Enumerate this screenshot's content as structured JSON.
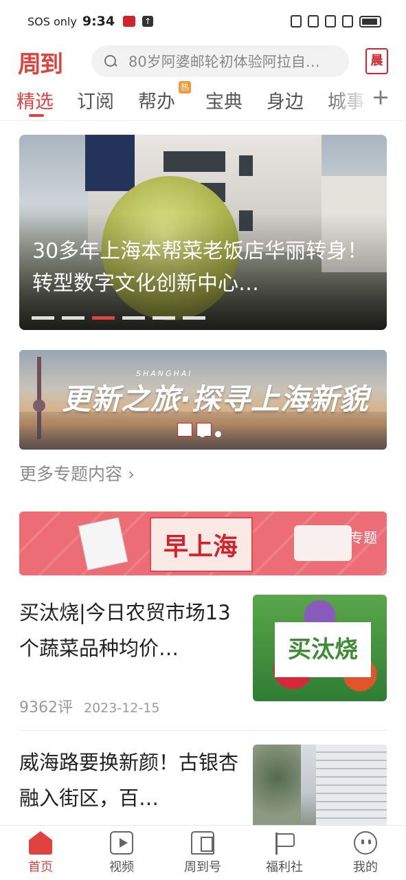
{
  "status_bar": {
    "carrier": "SOS only",
    "time": "9:34"
  },
  "header": {
    "logo": "周到",
    "search_placeholder": "80岁阿婆邮轮初体验阿拉自…",
    "badge_label": "晨"
  },
  "tabs": [
    {
      "label": "精选",
      "active": true
    },
    {
      "label": "订阅"
    },
    {
      "label": "帮办",
      "badge": "热"
    },
    {
      "label": "宝典"
    },
    {
      "label": "身边"
    },
    {
      "label": "城事"
    }
  ],
  "tabs_add_label": "+",
  "hero": {
    "title": "30多年上海本帮菜老饭店华丽转身！转型数字文化创新中心…",
    "dot_count": 6,
    "active_dot": 2
  },
  "topic_banner": {
    "title": "更新之旅·探寻上海新貌",
    "subtitle": "SHANGHAI"
  },
  "more_topics": "更多专题内容 ›",
  "morning_banner": {
    "title": "早上海",
    "tag": "专题"
  },
  "news": [
    {
      "title": "买汰烧|今日农贸市场13个蔬菜品种均价…",
      "comments": "9362评",
      "date": "2023-12-15",
      "thumb_label": "买汰烧"
    },
    {
      "title": "威海路要换新颜！古银杏融入街区，百…"
    }
  ],
  "bottom_nav": [
    {
      "label": "首页",
      "icon": "home-icon",
      "active": true
    },
    {
      "label": "视频",
      "icon": "video-icon"
    },
    {
      "label": "周到号",
      "icon": "building-icon"
    },
    {
      "label": "福利社",
      "icon": "flag-icon"
    },
    {
      "label": "我的",
      "icon": "face-icon"
    }
  ],
  "colors": {
    "accent": "#e0433d",
    "brand_red": "#d3222a"
  }
}
